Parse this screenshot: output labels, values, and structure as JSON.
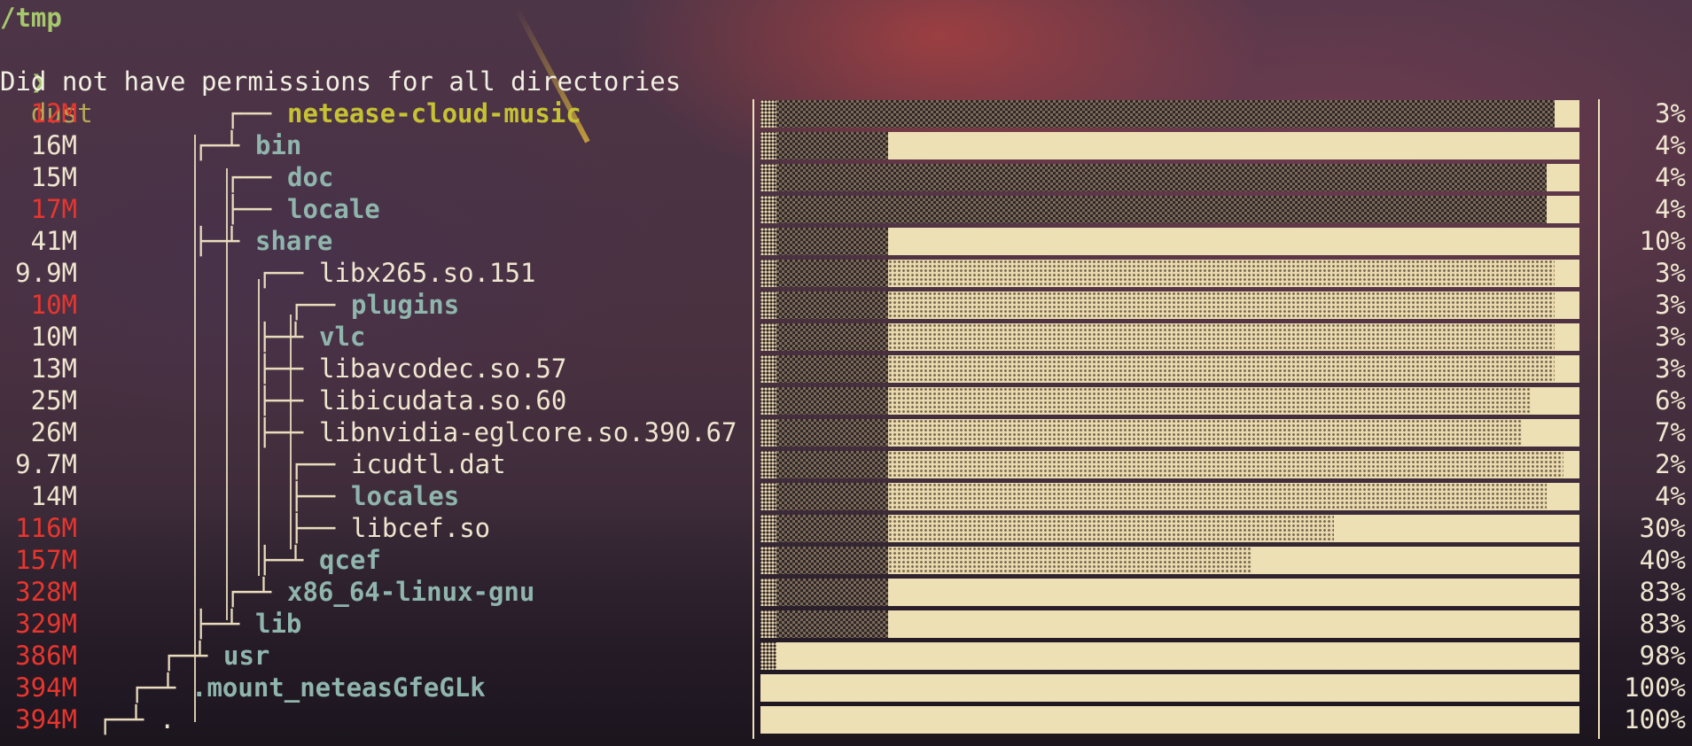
{
  "terminal": {
    "cwd": "/tmp",
    "prompt_symbol": "❯",
    "command": "dust",
    "warning": "Did not have permissions for all directories"
  },
  "colors": {
    "accent_green": "#a6c86c",
    "size_red": "#e8362e",
    "dir_teal": "#8fb5ad",
    "highlight_yellow": "#c6c233",
    "bar_fill": "#ede0b4"
  },
  "rows": [
    {
      "size": "12M",
      "red": true,
      "tree": "┌──",
      "name": "netease-cloud-music",
      "kind": "hl",
      "percent": "3%",
      "level": 4
    },
    {
      "size": "16M",
      "red": false,
      "tree": "┌─┴",
      "name": "bin",
      "kind": "dir",
      "percent": "4%",
      "level": 3
    },
    {
      "size": "15M",
      "red": false,
      "tree": "┌──",
      "name": "doc",
      "kind": "dir",
      "percent": "4%",
      "level": 4
    },
    {
      "size": "17M",
      "red": true,
      "tree": "├──",
      "name": "locale",
      "kind": "dir",
      "percent": "4%",
      "level": 4
    },
    {
      "size": "41M",
      "red": false,
      "tree": "├─┴",
      "name": "share",
      "kind": "dir",
      "percent": "10%",
      "level": 3
    },
    {
      "size": "9.9M",
      "red": false,
      "tree": "┌──",
      "name": "libx265.so.151",
      "kind": "file",
      "percent": "3%",
      "level": 5
    },
    {
      "size": "10M",
      "red": true,
      "tree": "┌──",
      "name": "plugins",
      "kind": "dir",
      "percent": "3%",
      "level": 6
    },
    {
      "size": "10M",
      "red": false,
      "tree": "├─┴",
      "name": "vlc",
      "kind": "dir",
      "percent": "3%",
      "level": 5
    },
    {
      "size": "13M",
      "red": false,
      "tree": "├──",
      "name": "libavcodec.so.57",
      "kind": "file",
      "percent": "3%",
      "level": 5
    },
    {
      "size": "25M",
      "red": false,
      "tree": "├──",
      "name": "libicudata.so.60",
      "kind": "file",
      "percent": "6%",
      "level": 5
    },
    {
      "size": "26M",
      "red": false,
      "tree": "├──",
      "name": "libnvidia-eglcore.so.390.67",
      "kind": "file",
      "percent": "7%",
      "level": 5
    },
    {
      "size": "9.7M",
      "red": false,
      "tree": "┌──",
      "name": "icudtl.dat",
      "kind": "file",
      "percent": "2%",
      "level": 6
    },
    {
      "size": "14M",
      "red": false,
      "tree": "├──",
      "name": "locales",
      "kind": "dir",
      "percent": "4%",
      "level": 6
    },
    {
      "size": "116M",
      "red": true,
      "tree": "├──",
      "name": "libcef.so",
      "kind": "file",
      "percent": "30%",
      "level": 6
    },
    {
      "size": "157M",
      "red": true,
      "tree": "├─┴",
      "name": "qcef",
      "kind": "dir",
      "percent": "40%",
      "level": 5
    },
    {
      "size": "328M",
      "red": true,
      "tree": "┌─┴",
      "name": "x86_64-linux-gnu",
      "kind": "dir",
      "percent": "83%",
      "level": 4
    },
    {
      "size": "329M",
      "red": true,
      "tree": "├─┴",
      "name": "lib",
      "kind": "dir",
      "percent": "83%",
      "level": 3
    },
    {
      "size": "386M",
      "red": true,
      "tree": "┌─┴",
      "name": "usr",
      "kind": "dir",
      "percent": "98%",
      "level": 2
    },
    {
      "size": "394M",
      "red": true,
      "tree": "┌─┴",
      "name": ".mount_neteasGfeGLk",
      "kind": "dir",
      "percent": "100%",
      "level": 1
    },
    {
      "size": "394M",
      "red": true,
      "tree": "┌─┴",
      "name": ".",
      "kind": "file",
      "percent": "100%",
      "level": 0
    }
  ]
}
